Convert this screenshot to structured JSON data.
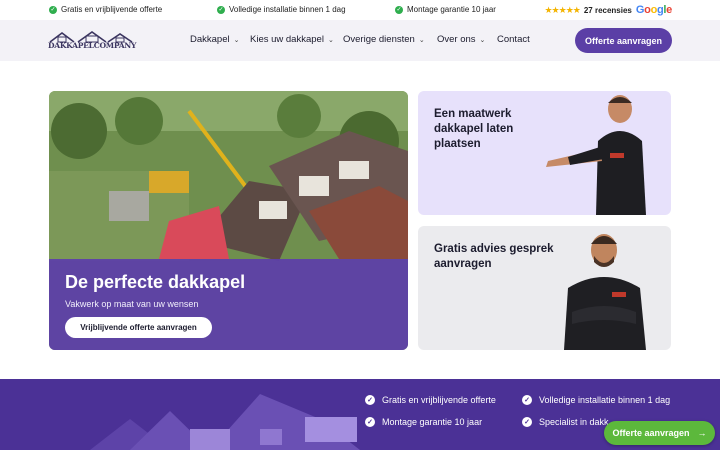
{
  "topbar": {
    "usps": [
      "Gratis en vrijblijvende offerte",
      "Volledige installatie binnen 1 dag",
      "Montage garantie 10 jaar"
    ],
    "reviews": "27 recensies",
    "stars": "★★★★★",
    "google": [
      "G",
      "o",
      "o",
      "g",
      "l",
      "e"
    ]
  },
  "logo": {
    "text": "DAKKAPELCOMPANY"
  },
  "nav": {
    "items": [
      {
        "label": "Dakkapel",
        "dropdown": true
      },
      {
        "label": "Kies uw dakkapel",
        "dropdown": true
      },
      {
        "label": "Overige diensten",
        "dropdown": true
      },
      {
        "label": "Over ons",
        "dropdown": true
      },
      {
        "label": "Contact",
        "dropdown": false
      }
    ],
    "cta": "Offerte aanvragen"
  },
  "hero": {
    "title": "De perfecte dakkapel",
    "subtitle": "Vakwerk op maat van uw wensen",
    "button": "Vrijblijvende offerte aanvragen"
  },
  "cards": [
    {
      "title": "Een maatwerk dakkapel laten plaatsen"
    },
    {
      "title": "Gratis advies gesprek aanvragen"
    }
  ],
  "band": {
    "usps": [
      "Gratis en vrijblijvende offerte",
      "Volledige installatie binnen 1 dag",
      "Montage garantie 10 jaar",
      "Specialist in dakk..."
    ]
  },
  "float_cta": {
    "label": "Offerte aanvragen",
    "arrow": "→"
  },
  "colors": {
    "brand_purple": "#5b3fa6",
    "green_check": "#2fae4e",
    "float_green": "#5cb83c",
    "card_lilac": "#e7e1fb"
  }
}
